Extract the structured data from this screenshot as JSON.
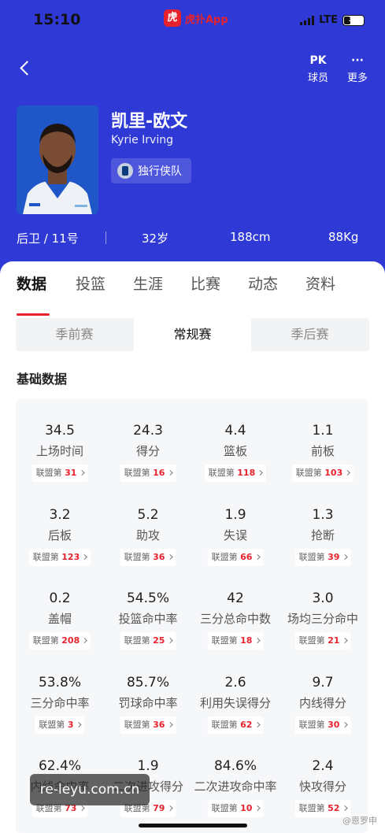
{
  "status": {
    "time": "15:10",
    "app_name": "虎扑App",
    "app_logo": "虎扑",
    "network": "LTE",
    "battery": "30"
  },
  "header": {
    "pk_icon": "PK",
    "pk_label": "球员",
    "more_icon": "···",
    "more_label": "更多"
  },
  "player": {
    "name_cn": "凯里-欧文",
    "name_en": "Kyrie Irving",
    "team": "独行侠队",
    "position_number": "后卫 / 11号",
    "age": "32岁",
    "height": "188cm",
    "weight": "88Kg"
  },
  "tabs": [
    "数据",
    "投篮",
    "生涯",
    "比赛",
    "动态",
    "资料"
  ],
  "season_tabs": [
    "季前赛",
    "常规赛",
    "季后赛"
  ],
  "section_title": "基础数据",
  "rank_prefix": "联盟第",
  "stats": [
    {
      "value": "34.5",
      "label": "上场时间",
      "rank": "31"
    },
    {
      "value": "24.3",
      "label": "得分",
      "rank": "16"
    },
    {
      "value": "4.4",
      "label": "篮板",
      "rank": "118"
    },
    {
      "value": "1.1",
      "label": "前板",
      "rank": "103"
    },
    {
      "value": "3.2",
      "label": "后板",
      "rank": "123"
    },
    {
      "value": "5.2",
      "label": "助攻",
      "rank": "36"
    },
    {
      "value": "1.9",
      "label": "失误",
      "rank": "66"
    },
    {
      "value": "1.3",
      "label": "抢断",
      "rank": "39"
    },
    {
      "value": "0.2",
      "label": "盖帽",
      "rank": "208"
    },
    {
      "value": "54.5%",
      "label": "投篮命中率",
      "rank": "25"
    },
    {
      "value": "42",
      "label": "三分总命中数",
      "rank": "18"
    },
    {
      "value": "3.0",
      "label": "场均三分命中",
      "rank": "21"
    },
    {
      "value": "53.8%",
      "label": "三分命中率",
      "rank": "3"
    },
    {
      "value": "85.7%",
      "label": "罚球命中率",
      "rank": "36"
    },
    {
      "value": "2.6",
      "label": "利用失误得分",
      "rank": "62"
    },
    {
      "value": "9.7",
      "label": "内线得分",
      "rank": "30"
    },
    {
      "value": "62.4%",
      "label": "内线命中率",
      "rank": "73"
    },
    {
      "value": "1.9",
      "label": "二次进攻得分",
      "rank": "79"
    },
    {
      "value": "84.6%",
      "label": "二次进攻命中率",
      "rank": "10"
    },
    {
      "value": "2.4",
      "label": "快攻得分",
      "rank": "52"
    }
  ],
  "watermark": {
    "site": "re-leyu.com.cn",
    "weibo": "@恩罗申"
  },
  "colors": {
    "primary": "#2f39d6",
    "accent": "#e6222d"
  }
}
